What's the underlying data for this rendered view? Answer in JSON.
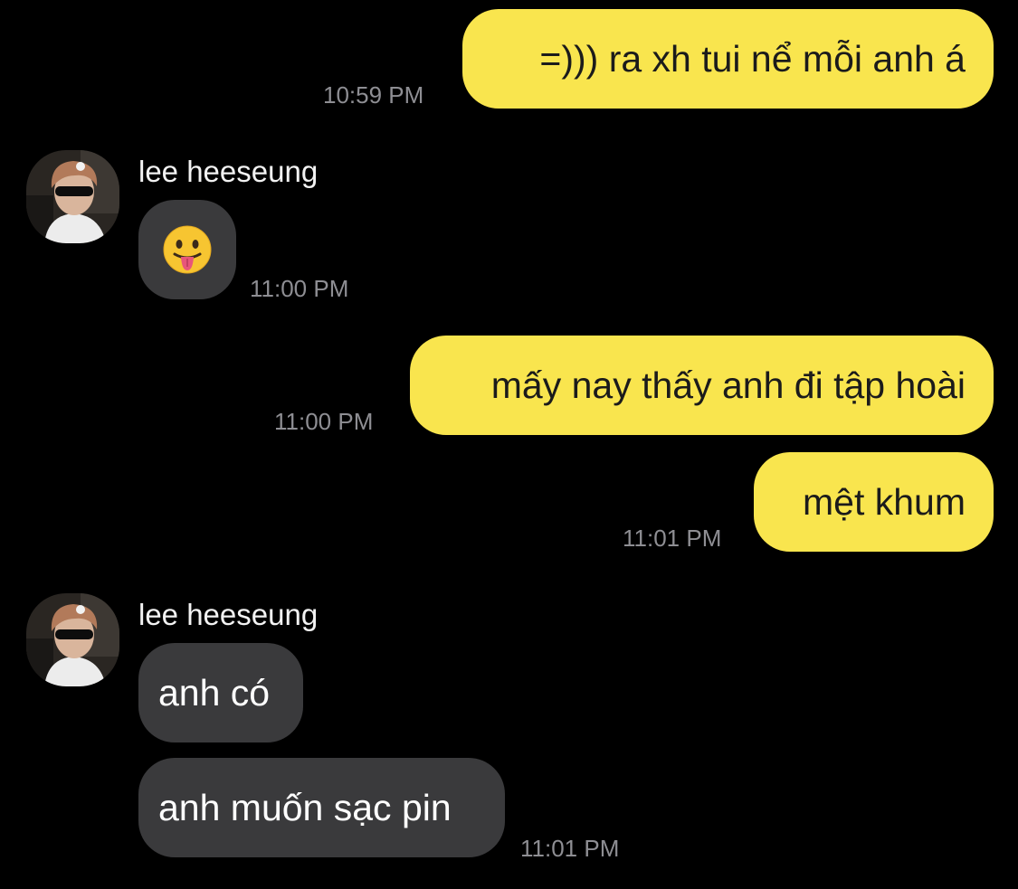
{
  "colors": {
    "background": "#000000",
    "outgoing_bubble": "#f9e54e",
    "incoming_bubble": "#3a3a3c",
    "timestamp": "#8e8e93"
  },
  "messages": [
    {
      "direction": "outgoing",
      "text": "=))) ra xh tui nể mỗi anh á",
      "time": "10:59 PM"
    },
    {
      "direction": "incoming",
      "sender": "lee heeseung",
      "emoji_icon": "face-with-tongue-icon",
      "time": "11:00 PM"
    },
    {
      "direction": "outgoing",
      "text": "mấy nay thấy anh đi tập hoài",
      "time": "11:00 PM"
    },
    {
      "direction": "outgoing",
      "text": "mệt khum",
      "time": "11:01 PM"
    },
    {
      "direction": "incoming",
      "sender": "lee heeseung",
      "text": "anh có"
    },
    {
      "direction": "incoming",
      "text": "anh muốn sạc pin",
      "time": "11:01 PM"
    }
  ]
}
